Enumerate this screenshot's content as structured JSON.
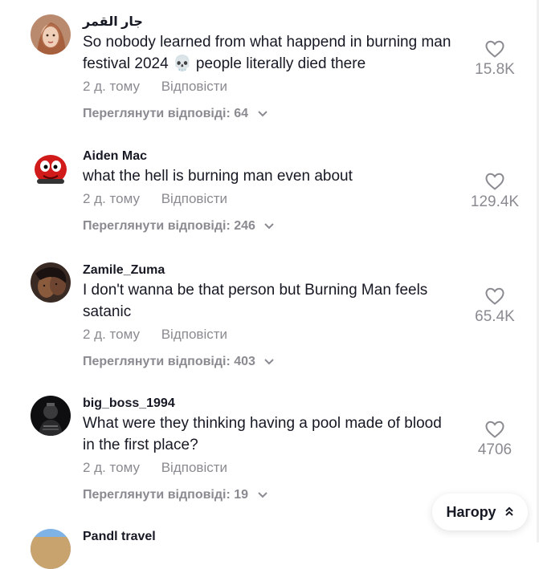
{
  "comments": [
    {
      "username": "جار القمر",
      "text": "So nobody learned from what happend in burning man festival 2024 💀 people literally died there",
      "time": "2 д. тому",
      "reply": "Відповісти",
      "view_replies": "Переглянути відповіді: 64",
      "likes": "15.8K"
    },
    {
      "username": "Aiden Mac",
      "text": "what the hell is burning man even about",
      "time": "2 д. тому",
      "reply": "Відповісти",
      "view_replies": "Переглянути відповіді: 246",
      "likes": "129.4K"
    },
    {
      "username": "Zamile_Zuma",
      "text": "I don't wanna be that person but Burning Man feels satanic",
      "time": "2 д. тому",
      "reply": "Відповісти",
      "view_replies": "Переглянути відповіді: 403",
      "likes": "65.4K"
    },
    {
      "username": "big_boss_1994",
      "text": "What were they thinking having a pool made of blood in the first place?",
      "time": "2 д. тому",
      "reply": "Відповісти",
      "view_replies": "Переглянути відповіді: 19",
      "likes": "4706"
    },
    {
      "username": "Pandl travel"
    }
  ],
  "back_to_top": "Нагору",
  "icons": {
    "like": "heart-outline-icon",
    "expand": "chevron-down-icon",
    "back_to_top": "double-chevron-up-icon"
  },
  "colors": {
    "text": "#161823",
    "secondary": "#8a8b91"
  }
}
